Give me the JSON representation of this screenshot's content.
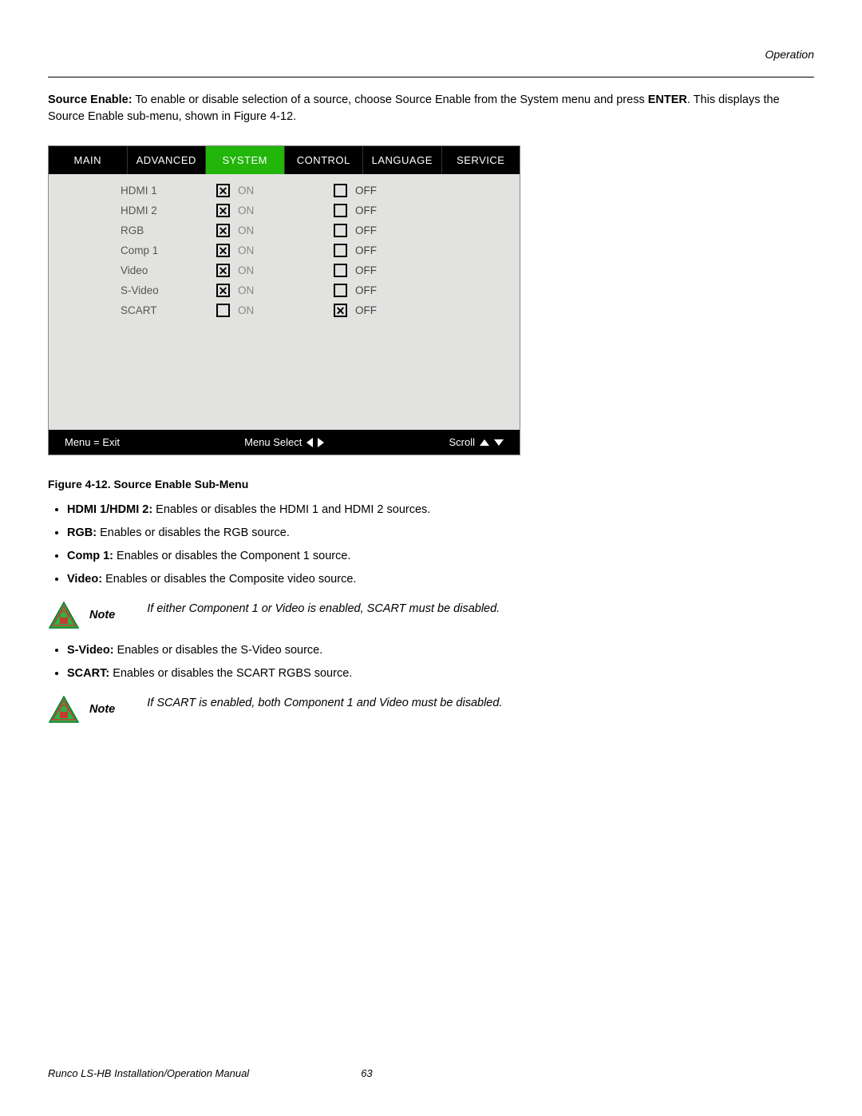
{
  "header": {
    "section": "Operation"
  },
  "intro": {
    "label": "Source Enable:",
    "text1": " To enable or disable selection of a source, choose Source Enable from the System menu and press ",
    "enter": "ENTER",
    "text2": ". This displays the Source Enable sub-menu, shown in Figure 4-12."
  },
  "osd": {
    "tabs": [
      {
        "label": "MAIN",
        "active": false
      },
      {
        "label": "ADVANCED",
        "active": false
      },
      {
        "label": "SYSTEM",
        "active": true
      },
      {
        "label": "CONTROL",
        "active": false
      },
      {
        "label": "LANGUAGE",
        "active": false
      },
      {
        "label": "SERVICE",
        "active": false
      }
    ],
    "rows": [
      {
        "name": "HDMI 1",
        "on_checked": true,
        "off_checked": false
      },
      {
        "name": "HDMI 2",
        "on_checked": true,
        "off_checked": false
      },
      {
        "name": "RGB",
        "on_checked": true,
        "off_checked": false
      },
      {
        "name": "Comp 1",
        "on_checked": true,
        "off_checked": false
      },
      {
        "name": "Video",
        "on_checked": true,
        "off_checked": false
      },
      {
        "name": "S-Video",
        "on_checked": true,
        "off_checked": false
      },
      {
        "name": "SCART",
        "on_checked": false,
        "off_checked": true
      }
    ],
    "on_label": "ON",
    "off_label": "OFF",
    "footer": {
      "menu_exit": "Menu = Exit",
      "menu_select": "Menu Select",
      "scroll": "Scroll"
    }
  },
  "caption": "Figure 4-12. Source Enable Sub-Menu",
  "bullets1": [
    {
      "b": "HDMI 1/HDMI 2:",
      "t": " Enables or disables the HDMI 1 and HDMI 2 sources."
    },
    {
      "b": "RGB:",
      "t": " Enables or disables the RGB source."
    },
    {
      "b": "Comp 1:",
      "t": " Enables or disables the Component 1 source."
    },
    {
      "b": "Video:",
      "t": " Enables or disables the Composite video source."
    }
  ],
  "note1": {
    "label": "Note",
    "text": "If either Component 1 or Video is enabled, SCART must be disabled."
  },
  "bullets2": [
    {
      "b": "S-Video:",
      "t": " Enables or disables the S-Video source."
    },
    {
      "b": "SCART:",
      "t": " Enables or disables the SCART RGBS source."
    }
  ],
  "note2": {
    "label": "Note",
    "text": "If SCART is enabled, both Component 1 and Video must be disabled."
  },
  "footer": {
    "title": "Runco LS-HB Installation/Operation Manual",
    "page": "63"
  }
}
